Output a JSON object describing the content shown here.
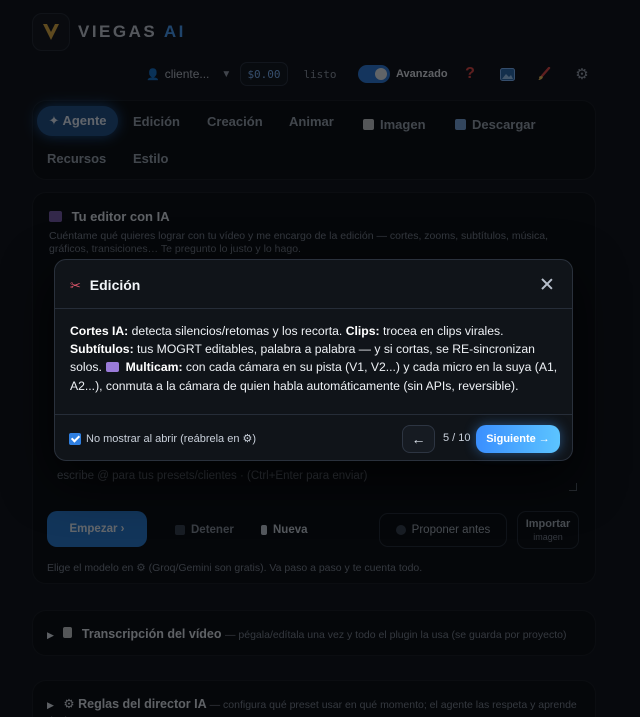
{
  "header": {
    "brand_main": "VIEGAS",
    "brand_accent": "AI"
  },
  "toolbar": {
    "client_label": "cliente...",
    "balance": "$0.00",
    "status": "listo",
    "advanced_label": "Avanzado",
    "advanced_on": true,
    "help_icon": "question-icon"
  },
  "tabs": {
    "agent": "✦ Agente",
    "edition": "Edición",
    "creation": "Creación",
    "animate": "Animar",
    "image": "Imagen",
    "download": "Descargar",
    "resources": "Recursos",
    "style": "Estilo"
  },
  "editor": {
    "title": "Tu editor con IA",
    "subtitle": "Cuéntame qué quieres lograr con tu vídeo y me encargo de la edición — cortes, zooms, subtítulos, música, gráficos, transiciones… Te pregunto lo justo y lo hago.",
    "input_placeholder": "escribe @ para tus presets/clientes · (Ctrl+Enter para enviar)",
    "start_button": "Empezar ›",
    "stop_button": "Detener",
    "new_button": "Nueva",
    "propose_button": "Proponer antes",
    "import_button": "Importar",
    "import_sub": "imagen",
    "model_hint": "Elige el modelo en ⚙ (Groq/Gemini son gratis). Va paso a paso y te cuenta todo."
  },
  "sections": {
    "transcription_title": "Transcripción del vídeo",
    "transcription_desc": "— pégala/edítala una vez y todo el plugin la usa (se guarda por proyecto)",
    "rules_title": "⚙ Reglas del director IA",
    "rules_desc": "— configura qué preset usar en qué momento; el agente las respeta y aprende de ti nuevo."
  },
  "modal": {
    "title": "Edición",
    "body_cuts_label": "Cortes IA:",
    "body_cuts_text": "detecta silencios/retomas y los recorta.",
    "body_clips_label": "Clips:",
    "body_clips_text": "trocea en clips virales.",
    "body_subs_label": "Subtítulos:",
    "body_subs_text": "tus MOGRT editables, palabra a palabra — y si cortas, se RE-sincronizan solos.",
    "body_multicam_label": "Multicam:",
    "body_multicam_text": "con cada cámara en su pista (V1, V2...) y cada micro en la suya (A1, A2...), conmuta a la cámara de quien habla automáticamente (sin APIs, reversible).",
    "checkbox_label": "No mostrar al abrir (reábrela en ⚙)",
    "checkbox_checked": true,
    "prev_button": "←",
    "page_counter": "5 / 10",
    "next_button": "Siguiente →"
  },
  "colors": {
    "accent": "#3a8fff",
    "background": "#07090d",
    "modal_bg": "#101419"
  }
}
